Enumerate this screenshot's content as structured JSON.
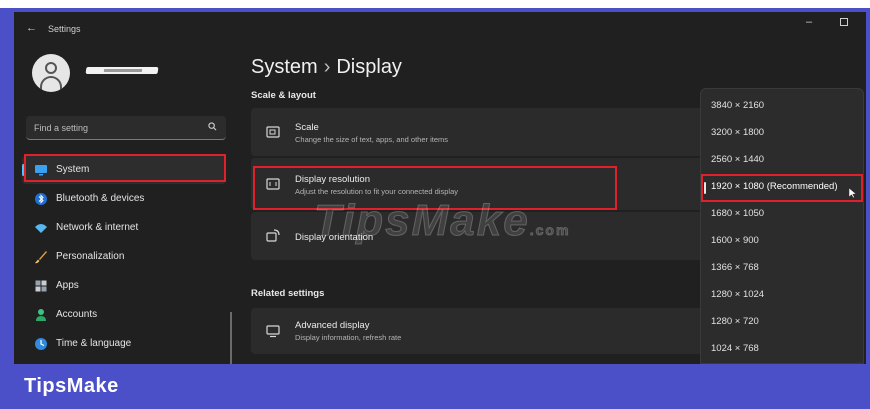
{
  "window": {
    "title": "Settings",
    "back_glyph": "←",
    "minimize_glyph": "–"
  },
  "sidebar": {
    "search_placeholder": "Find a setting",
    "items": [
      {
        "label": "System",
        "icon": "monitor-icon",
        "active": true
      },
      {
        "label": "Bluetooth & devices",
        "icon": "bluetooth-icon"
      },
      {
        "label": "Network & internet",
        "icon": "wifi-icon"
      },
      {
        "label": "Personalization",
        "icon": "brush-icon"
      },
      {
        "label": "Apps",
        "icon": "apps-icon"
      },
      {
        "label": "Accounts",
        "icon": "person-icon"
      },
      {
        "label": "Time & language",
        "icon": "globe-clock-icon"
      }
    ]
  },
  "main": {
    "breadcrumb": {
      "parent": "System",
      "separator": "›",
      "current": "Display"
    },
    "scale_section_label": "Scale & layout",
    "cards": [
      {
        "title": "Scale",
        "subtitle": "Change the size of text, apps, and other items",
        "icon": "scale-icon"
      },
      {
        "title": "Display resolution",
        "subtitle": "Adjust the resolution to fit your connected display",
        "icon": "resolution-icon"
      },
      {
        "title": "Display orientation",
        "subtitle": "",
        "icon": "orientation-icon"
      }
    ],
    "related_section_label": "Related settings",
    "related_cards": [
      {
        "title": "Advanced display",
        "subtitle": "Display information, refresh rate",
        "icon": "advanced-display-icon"
      }
    ]
  },
  "resolution_dropdown": {
    "selected": "1920 × 1080 (Recommended)",
    "options": [
      "3840 × 2160",
      "3200 × 1800",
      "2560 × 1440",
      "1920 × 1080 (Recommended)",
      "1680 × 1050",
      "1600 × 900",
      "1366 × 768",
      "1280 × 1024",
      "1280 × 720",
      "1024 × 768"
    ]
  },
  "watermark": {
    "text": "TipsMake",
    "suffix": ".com"
  },
  "footer": {
    "brand": "TipsMake"
  },
  "colors": {
    "frame": "#4b50c8",
    "window_bg": "#202020",
    "card_bg": "#2b2b2b",
    "highlight_border": "#e0212b",
    "accent": "#4cc2ff"
  }
}
